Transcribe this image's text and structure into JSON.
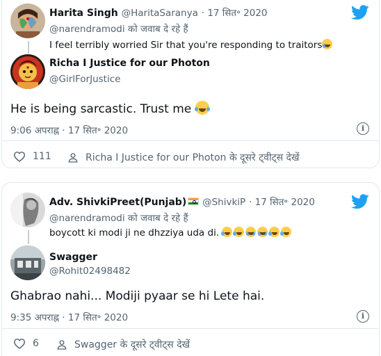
{
  "tweet1": {
    "parent": {
      "name": "Harita Singh",
      "handle": "@HaritaSaranya",
      "date": "· 17 सित॰ 2020",
      "reply_to": "@narendramodi को जवाब दे रहे हैं",
      "text": "I feel terribly worried Sir that you're responding to traitors"
    },
    "reply": {
      "name": "Richa I Justice for our Photon",
      "handle": "@GirlForJustice",
      "text": "He is being sarcastic. Trust me",
      "timestamp": "9:06 अपराह्न · 17 सित॰ 2020"
    },
    "actions": {
      "likes": "111",
      "more_tweets": "Richa I Justice for our Photon के दूसरे ट्वीट्स देखें"
    }
  },
  "tweet2": {
    "parent": {
      "name": "Adv. ShivkiPreet(Punjab)",
      "handle": "@ShivkiP",
      "date": "· 17 सित॰ 2020",
      "reply_to": "@narendramodi को जवाब दे रहे हैं",
      "text": "boycott ki modi ji ne dhzziya uda di."
    },
    "reply": {
      "name": "Swagger",
      "handle": "@Rohit02498482",
      "text": "Ghabrao nahi... Modiji pyaar se hi Lete hai.",
      "timestamp": "9:35 अपराह्न · 17 सित॰ 2020"
    },
    "actions": {
      "likes": "6",
      "more_tweets": "Swagger के दूसरे ट्वीट्स देखें"
    }
  },
  "colors": {
    "twitter_blue": "#1da1f2",
    "text_primary": "#0f1419",
    "text_secondary": "#536471",
    "border": "#e1e8ed"
  },
  "icons": [
    "twitter-bird-icon",
    "info-icon",
    "heart-icon",
    "person-icon",
    "india-flag-icon",
    "crying-laughing-emoji-icon",
    "loudly-crying-emoji-icon"
  ]
}
